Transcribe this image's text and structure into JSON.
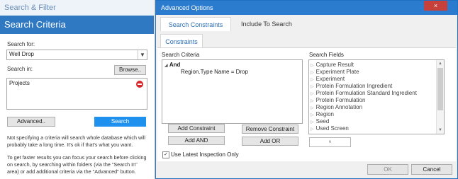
{
  "left_panel": {
    "top_title": "Search & Filter",
    "header_title": "Search Criteria",
    "search_for_label": "Search for:",
    "search_for_value": "Well Drop",
    "search_in_label": "Search in:",
    "browse_button": "Browse..",
    "search_in_item": "Projects",
    "advanced_button": "Advanced..",
    "search_button": "Search",
    "help_text_1": "Not specifying a criteria will search whole database which will probably take a long time. It's ok if that's what you want.",
    "help_text_2": "To get faster results you can focus your search before clicking on search, by searching within folders (via the \"Search In\" area) or add additional criteria via the \"Advanced\" button."
  },
  "dialog": {
    "title": "Advanced Options",
    "close_glyph": "×",
    "tabs": [
      {
        "label": "Search Constraints",
        "active": true
      },
      {
        "label": "Include To Search",
        "active": false
      }
    ],
    "subtab": "Constraints",
    "search_criteria_label": "Search Criteria",
    "criteria_root": "And",
    "criteria_child": "Region.Type Name = Drop",
    "search_fields_label": "Search Fields",
    "search_fields": [
      "Capture Result",
      "Experiment Plate",
      "Experiment",
      "Protein Formulation Ingredient",
      "Protein Formulation Standard Ingredient",
      "Protein Formulation",
      "Region Annotation",
      "Region",
      "Seed",
      "Used Screen"
    ],
    "buttons": {
      "add_constraint": "Add Constraint",
      "remove_constraint": "Remove Constraint",
      "add_and": "Add AND",
      "add_or": "Add OR",
      "ok": "OK",
      "cancel": "Cancel"
    },
    "use_latest_label": "Use Latest Inspection Only",
    "use_latest_checked": true
  },
  "colors": {
    "header_blue": "#2f78c2",
    "title_blue": "#2b7ccf",
    "search_button": "#1e90ee",
    "remove_red": "#d9262b"
  }
}
